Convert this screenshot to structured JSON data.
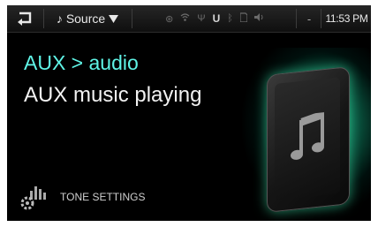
{
  "statusbar": {
    "back_icon": "back-arrow-icon",
    "source_label": "Source",
    "source_icon": "music-note-icon",
    "dropdown_icon": "triangle-down-icon",
    "status_icons": [
      "settings-icon",
      "wifi-icon",
      "usb-icon",
      "u-icon",
      "bluetooth-icon",
      "sd-card-icon",
      "volume-icon"
    ],
    "u_glyph": "U",
    "separator": "-",
    "time": "11:53 PM"
  },
  "main": {
    "title": "AUX > audio",
    "subtitle": "AUX music playing"
  },
  "footer": {
    "tone_label": "TONE SETTINGS",
    "tone_icon": "gear-equalizer-icon"
  },
  "artwork": {
    "icon": "music-note-icon",
    "glow_color": "#2ddc96"
  },
  "colors": {
    "title": "#5ff4e6",
    "background": "#000000"
  }
}
